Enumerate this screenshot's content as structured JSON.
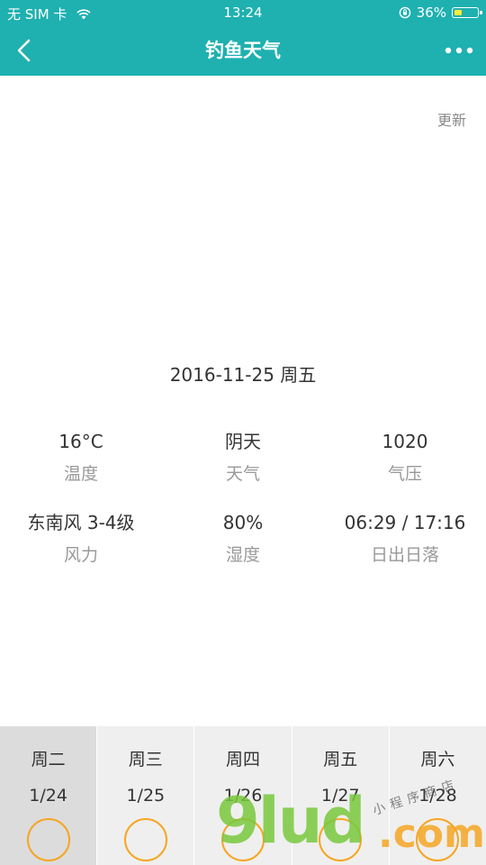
{
  "status_bar": {
    "carrier": "无 SIM 卡",
    "time": "13:24",
    "battery_percent": "36%",
    "battery_level": 0.36,
    "icons": [
      "wifi-icon",
      "rotation-lock-icon",
      "battery-icon"
    ]
  },
  "nav": {
    "title": "钓鱼天气",
    "back_icon": "back-arrow-icon",
    "more_icon": "more-dots-icon"
  },
  "refresh_label": "更新",
  "date_text": "2016-11-25 周五",
  "info": {
    "row1": [
      {
        "value": "16°C",
        "label": "温度"
      },
      {
        "value": "阴天",
        "label": "天气"
      },
      {
        "value": "1020",
        "label": "气压"
      }
    ],
    "row2": [
      {
        "value": "东南风 3-4级",
        "label": "风力"
      },
      {
        "value": "80%",
        "label": "湿度"
      },
      {
        "value": "06:29 / 17:16",
        "label": "日出日落"
      }
    ]
  },
  "week": [
    {
      "name": "周二",
      "date": "1/24",
      "selected": true
    },
    {
      "name": "周三",
      "date": "1/25",
      "selected": false
    },
    {
      "name": "周四",
      "date": "1/26",
      "selected": false
    },
    {
      "name": "周五",
      "date": "1/27",
      "selected": false
    },
    {
      "name": "周六",
      "date": "1/28",
      "selected": false
    }
  ],
  "watermark": {
    "main": "9lud",
    "dot": ".com",
    "small": "小程序商店"
  },
  "colors": {
    "accent": "#1fb0b0",
    "ring": "#f5a623",
    "label": "#999999",
    "text": "#333333"
  }
}
